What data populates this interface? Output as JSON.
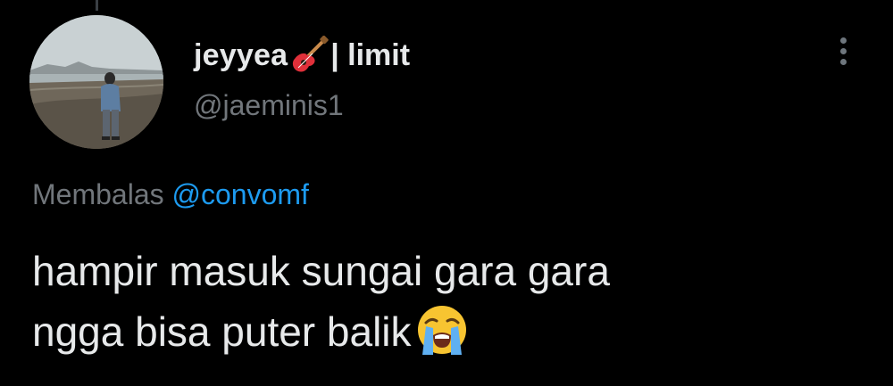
{
  "tweet": {
    "author": {
      "display_name": "jeyyea",
      "name_emoji": "guitar-icon",
      "name_suffix": "| limit",
      "handle": "@jaeminis1",
      "avatar": "avatar-photo-person-on-beach"
    },
    "reply": {
      "prefix": "Membalas",
      "mention": "@convomf"
    },
    "text": {
      "line1": "hampir masuk sungai gara gara",
      "line2": "ngga bisa puter balik",
      "trailing_emoji": "loudly-crying-face-icon"
    },
    "menu_icon": "more-vertical-icon"
  },
  "colors": {
    "background": "#000000",
    "primary_text": "#e7e9ea",
    "secondary_text": "#71767b",
    "link": "#1d9bf0"
  }
}
